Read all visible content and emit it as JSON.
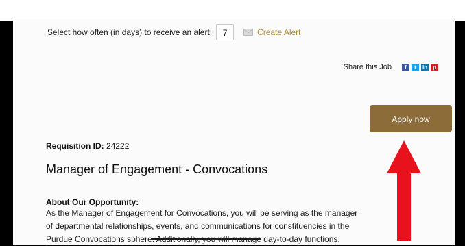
{
  "alert": {
    "label": "Select how often (in days) to receive an alert:",
    "days_value": "7",
    "create_label": "Create Alert"
  },
  "share": {
    "label": "Share this Job",
    "icons": [
      "facebook-icon",
      "twitter-icon",
      "linkedin-icon",
      "pinterest-icon"
    ],
    "colors": {
      "facebook": "#3b5998",
      "twitter": "#1da1f2",
      "linkedin": "#0e76a8",
      "pinterest": "#cb2027"
    }
  },
  "apply": {
    "label": "Apply now",
    "color": "#8c6d3a"
  },
  "requisition": {
    "label": "Requisition ID:",
    "value": "24222"
  },
  "job_title": "Manager of Engagement - Convocations",
  "opportunity": {
    "heading": "About Our Opportunity:",
    "line1": "As the Manager of Engagement for Convocations, you will be serving as the manager",
    "line2": "of departmental relationships, events, and communications for constituencies in the",
    "line3_start": "Purdue Convocations sphere",
    "line3_struck": ". Additionally, you will manage",
    "line3_end": " day-to-day functions,"
  },
  "annotation": {
    "arrow_color": "#e8121c"
  }
}
